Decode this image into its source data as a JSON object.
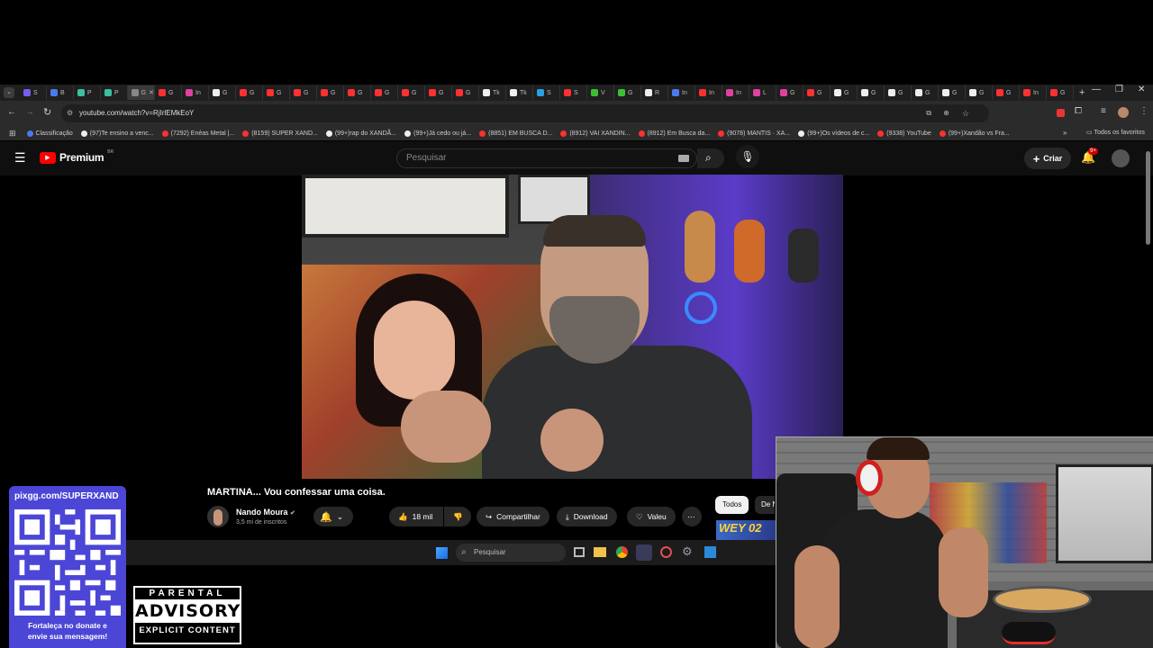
{
  "browser": {
    "tabs": [
      "S",
      "B",
      "P",
      "P",
      "G",
      "G",
      "In",
      "G",
      "G",
      "G",
      "G",
      "G",
      "G",
      "G",
      "G",
      "G",
      "G",
      "Tk",
      "Tk",
      "S",
      "S",
      "V",
      "G",
      "R",
      "In",
      "In",
      "In",
      "L",
      "G",
      "G",
      "G",
      "G",
      "G",
      "G",
      "G",
      "G",
      "G",
      "In",
      "G"
    ],
    "active_tab": 4,
    "url": "youtube.com/watch?v=RjIrlEMkEoY",
    "all_bookmarks_label": "Todos os favoritos",
    "bookmarks": [
      "Classificação",
      "(97)Te ensino a venc...",
      "(7292) Enéas Metal |...",
      "(8159) SUPER XAND...",
      "(99+)rap do XANDÃ...",
      "(99+)Já cedo ou já...",
      "(8851) EM BUSCA D...",
      "(8912) VAI XANDIN...",
      "(8912) Em Busca da...",
      "(9078) MANTIS · XA...",
      "(99+)Os vídeos de c...",
      "(9338) YouTube",
      "(99+)Xandão vs Fra..."
    ]
  },
  "youtube": {
    "logo_text": "Premium",
    "logo_badge": "BR",
    "search_placeholder": "Pesquisar",
    "create_label": "Criar",
    "notif_badge": "9+",
    "video_title": "MARTINA... Vou confessar uma coisa.",
    "channel_name": "Nando Moura",
    "subscribers": "3,5 mi de inscritos",
    "likes": "18 mil",
    "share_label": "Compartilhar",
    "download_label": "Download",
    "thanks_label": "Valeu",
    "chip_all": "Todos",
    "chip_next": "De N",
    "thumb_text": "WEY 02"
  },
  "taskbar": {
    "search_placeholder": "Pesquisar"
  },
  "stream_overlay": {
    "donate_url": "pixgg.com/SUPERXAND",
    "donate_text_1": "Fortaleça no donate e",
    "donate_text_2": "envie sua mensagem!",
    "advisory_top": "PARENTAL",
    "advisory_mid": "ADVISORY",
    "advisory_bottom": "EXPLICIT CONTENT"
  },
  "colors": {
    "yt_red": "#ff0000",
    "donate_panel": "#4b46d6",
    "video_purple": "#5a3cc8"
  }
}
